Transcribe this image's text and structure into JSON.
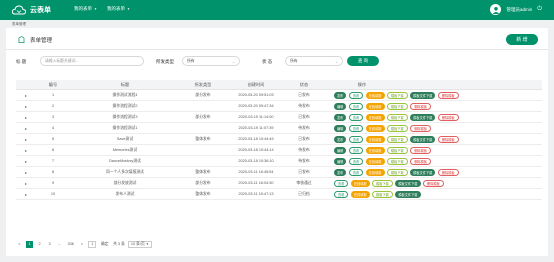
{
  "app": {
    "name": "云表单"
  },
  "topnav": [
    {
      "label": "我的表单"
    },
    {
      "label": "我的表单"
    }
  ],
  "user": {
    "label": "管理员admin"
  },
  "breadcrumb": "表单管理",
  "page": {
    "title": "表单管理",
    "new_button": "新 增"
  },
  "filters": {
    "title_label": "标 题",
    "title_placeholder": "请输入标题关键词...",
    "type_label": "所发类型",
    "type_value": "所有",
    "status_label": "状 态",
    "status_value": "所有",
    "search_button": "查 询"
  },
  "table": {
    "columns": [
      "",
      "编号",
      "标题",
      "所发类型",
      "创建时间",
      "状态",
      "操作"
    ],
    "rows": [
      {
        "no": "1",
        "title": "操作测试流程4",
        "type": "部分发布",
        "created": "2020-03-20 09:51:03",
        "status": "已发布",
        "ops": [
          [
            "发布",
            "g"
          ],
          [
            "查看",
            "ol"
          ],
          [
            "在线填报",
            "o"
          ],
          [
            "模板下载",
            "oy"
          ],
          [
            "模板文件下载",
            "g"
          ],
          [
            "删除模板",
            "r"
          ]
        ]
      },
      {
        "no": "2",
        "title": "操作流程测试2",
        "type": "",
        "created": "2020-03-20 09:47:34",
        "status": "待发布",
        "ops": [
          [
            "编辑",
            "g"
          ],
          [
            "查看",
            "ol"
          ],
          [
            "在线填报",
            "o"
          ],
          [
            "模板下载",
            "oy"
          ],
          [
            "删除模板",
            "r"
          ]
        ]
      },
      {
        "no": "3",
        "title": "操作流程测试3",
        "type": "部分发布",
        "created": "2020-03-19 11:14:00",
        "status": "已发布",
        "ops": [
          [
            "发布",
            "g"
          ],
          [
            "查看",
            "ol"
          ],
          [
            "在线填报",
            "o"
          ],
          [
            "模板下载",
            "oy"
          ],
          [
            "模板文件下载",
            "g"
          ],
          [
            "删除模板",
            "r"
          ]
        ]
      },
      {
        "no": "4",
        "title": "操作流程测试1",
        "type": "",
        "created": "2020-03-19 11:07:39",
        "status": "待发布",
        "ops": [
          [
            "编辑",
            "g"
          ],
          [
            "查看",
            "ol"
          ],
          [
            "在线填报",
            "o"
          ],
          [
            "模板下载",
            "oy"
          ],
          [
            "删除模板",
            "r"
          ]
        ]
      },
      {
        "no": "5",
        "title": "Save测试",
        "type": "整体发布",
        "created": "2020-03-18 10:44:49",
        "status": "已发布",
        "ops": [
          [
            "发布",
            "g"
          ],
          [
            "查看",
            "ol"
          ],
          [
            "在线填报",
            "o"
          ],
          [
            "模板下载",
            "oy"
          ],
          [
            "模板文件下载",
            "g"
          ],
          [
            "删除模板",
            "r"
          ]
        ]
      },
      {
        "no": "6",
        "title": "Memories测试",
        "type": "",
        "created": "2020-03-18 10:44:14",
        "status": "待发布",
        "ops": [
          [
            "编辑",
            "g"
          ],
          [
            "查看",
            "ol"
          ],
          [
            "在线填报",
            "o"
          ],
          [
            "模板下载",
            "oy"
          ],
          [
            "删除模板",
            "r"
          ]
        ]
      },
      {
        "no": "7",
        "title": "DanceMonkey测试",
        "type": "",
        "created": "2020-03-18 10:36:10",
        "status": "待发布",
        "ops": [
          [
            "编辑",
            "g"
          ],
          [
            "查看",
            "ol"
          ],
          [
            "在线填报",
            "o"
          ],
          [
            "模板下载",
            "oy"
          ],
          [
            "删除模板",
            "r"
          ]
        ]
      },
      {
        "no": "8",
        "title": "同一个人多次填报测试",
        "type": "整体发布",
        "created": "2020-03-11 16:45:54",
        "status": "已发布",
        "ops": [
          [
            "发布",
            "g"
          ],
          [
            "查看",
            "ol"
          ],
          [
            "在线填报",
            "o"
          ],
          [
            "模板下载",
            "oy"
          ],
          [
            "模板文件下载",
            "g"
          ],
          [
            "删除模板",
            "r"
          ]
        ]
      },
      {
        "no": "9",
        "title": "部分发放测试",
        "type": "部分发布",
        "created": "2020-03-11 16:04:30",
        "status": "审核通过",
        "ops": [
          [
            "查看",
            "ol"
          ],
          [
            "在线填报",
            "o"
          ],
          [
            "模板下载",
            "oy"
          ],
          [
            "模板文件下载",
            "g"
          ],
          [
            "删除模板",
            "r"
          ]
        ]
      },
      {
        "no": "10",
        "title": "发布人测试",
        "type": "整体发布",
        "created": "2020-03-11 15:47:13",
        "status": "已归档",
        "ops": [
          [
            "查看",
            "ol"
          ],
          [
            "在线填报",
            "o"
          ],
          [
            "模板下载",
            "oy"
          ],
          [
            "模板文件下载",
            "g"
          ]
        ]
      }
    ]
  },
  "pager": {
    "prev": "<",
    "pages": [
      "1",
      "2",
      "3",
      "...",
      "336"
    ],
    "next": ">",
    "goto_value": "1",
    "goto_label": "确定",
    "total": "共 3 条",
    "page_size": "10 条/页"
  },
  "colors": {
    "brand": "#00936b",
    "orange": "#f5a300"
  }
}
